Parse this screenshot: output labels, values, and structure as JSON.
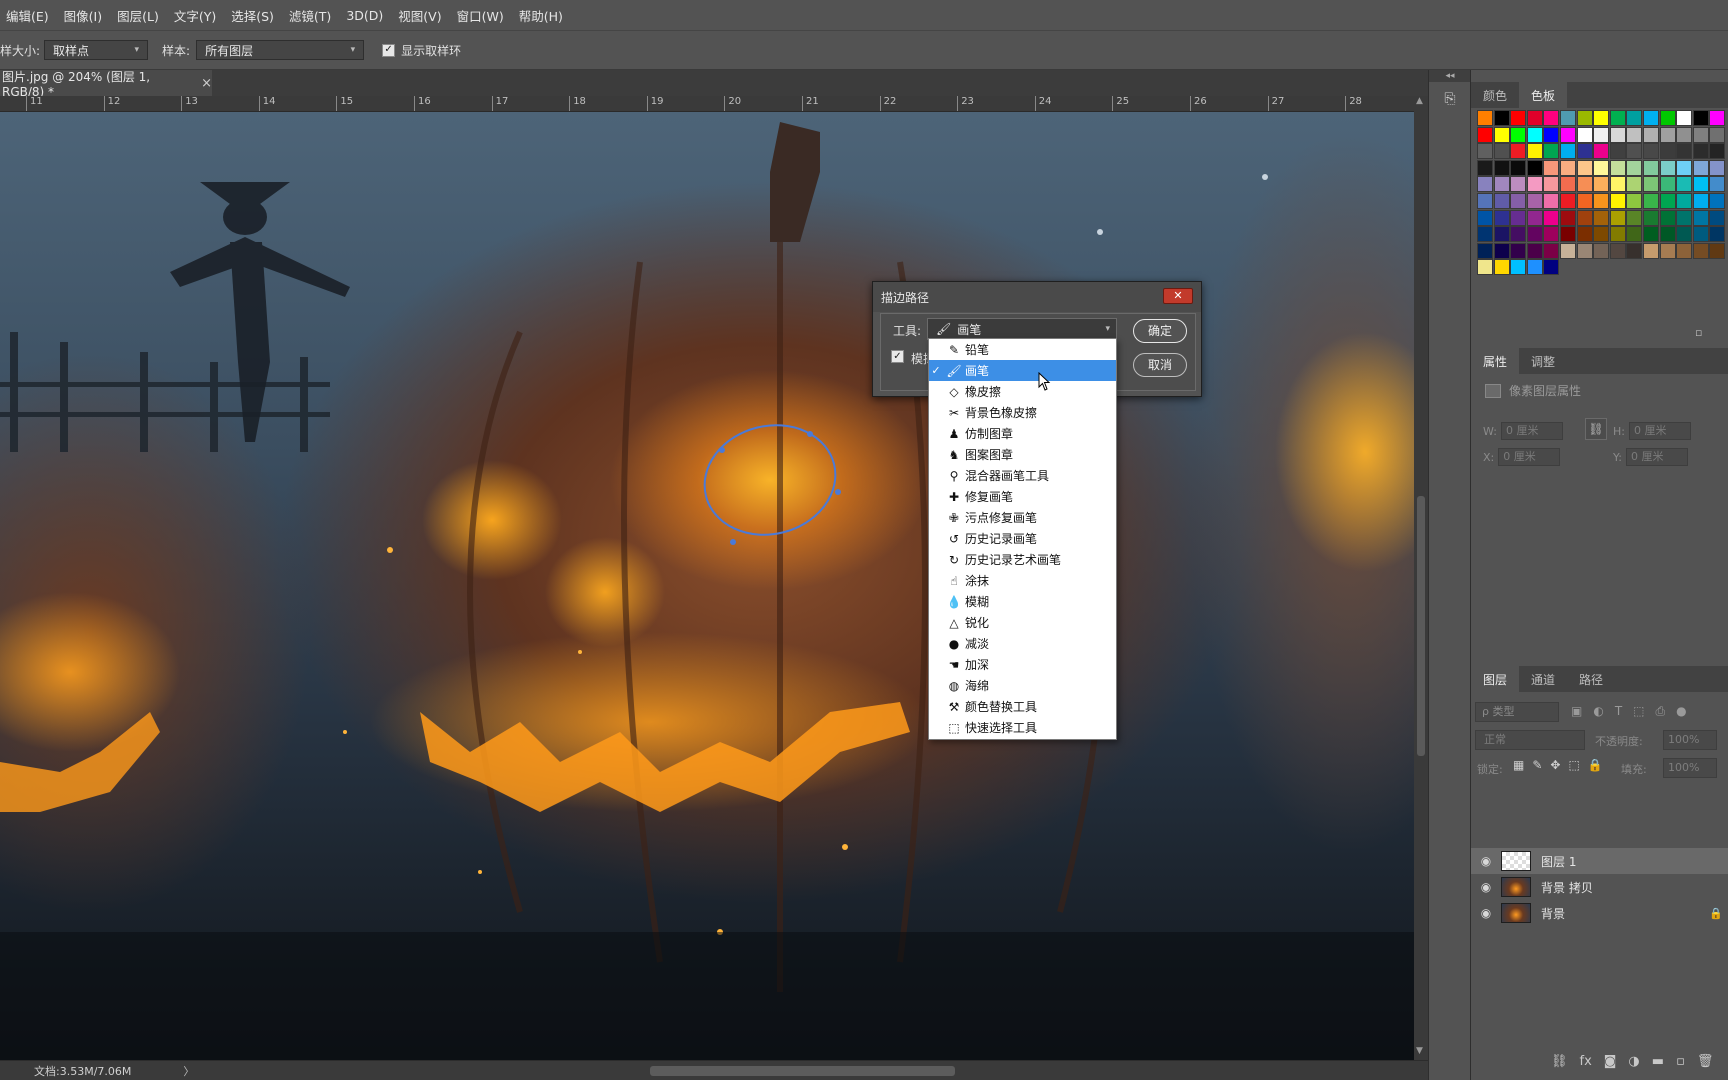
{
  "menubar": {
    "items": [
      "编辑(E)",
      "图像(I)",
      "图层(L)",
      "文字(Y)",
      "选择(S)",
      "滤镜(T)",
      "3D(D)",
      "视图(V)",
      "窗口(W)",
      "帮助(H)"
    ]
  },
  "options": {
    "sample_size_label": "样大小:",
    "sample_size_value": "取样点",
    "sample_label": "样本:",
    "sample_value": "所有图层",
    "show_ring_label": "显示取样环"
  },
  "document": {
    "tab_title": "图片.jpg @ 204% (图层 1, RGB/8) *",
    "close_glyph": "×",
    "status_text": "文档:3.53M/7.06M",
    "status_arrow": "〉"
  },
  "ruler": {
    "numbers": [
      "11",
      "12",
      "13",
      "14",
      "15",
      "16",
      "17",
      "18",
      "19",
      "20",
      "21",
      "22",
      "23",
      "24",
      "25",
      "26",
      "27",
      "28"
    ]
  },
  "dialog": {
    "title": "描边路径",
    "close_glyph": "✕",
    "tool_label": "工具:",
    "tool_value": "画笔",
    "simulate_label": "模拟",
    "ok_label": "确定",
    "cancel_label": "取消"
  },
  "tool_dropdown": {
    "selected_index": 1,
    "check_glyph": "✓",
    "items": [
      {
        "label": "铅笔",
        "icon": "pencil-icon",
        "glyph": "✎"
      },
      {
        "label": "画笔",
        "icon": "brush-icon",
        "glyph": "🖌"
      },
      {
        "label": "橡皮擦",
        "icon": "eraser-icon",
        "glyph": "◇"
      },
      {
        "label": "背景色橡皮擦",
        "icon": "background-eraser-icon",
        "glyph": "✂"
      },
      {
        "label": "仿制图章",
        "icon": "clone-stamp-icon",
        "glyph": "♟"
      },
      {
        "label": "图案图章",
        "icon": "pattern-stamp-icon",
        "glyph": "♞"
      },
      {
        "label": "混合器画笔工具",
        "icon": "mixer-brush-icon",
        "glyph": "⚲"
      },
      {
        "label": "修复画笔",
        "icon": "healing-brush-icon",
        "glyph": "✚"
      },
      {
        "label": "污点修复画笔",
        "icon": "spot-healing-icon",
        "glyph": "✙"
      },
      {
        "label": "历史记录画笔",
        "icon": "history-brush-icon",
        "glyph": "↺"
      },
      {
        "label": "历史记录艺术画笔",
        "icon": "art-history-brush-icon",
        "glyph": "↻"
      },
      {
        "label": "涂抹",
        "icon": "smudge-icon",
        "glyph": "☝"
      },
      {
        "label": "模糊",
        "icon": "blur-icon",
        "glyph": "💧"
      },
      {
        "label": "锐化",
        "icon": "sharpen-icon",
        "glyph": "△"
      },
      {
        "label": "减淡",
        "icon": "dodge-icon",
        "glyph": "●"
      },
      {
        "label": "加深",
        "icon": "burn-icon",
        "glyph": "☚"
      },
      {
        "label": "海绵",
        "icon": "sponge-icon",
        "glyph": "◍"
      },
      {
        "label": "颜色替换工具",
        "icon": "color-replacement-icon",
        "glyph": "⚒"
      },
      {
        "label": "快速选择工具",
        "icon": "quick-selection-icon",
        "glyph": "⬚"
      }
    ]
  },
  "panels": {
    "color_tabs": [
      "颜色",
      "色板"
    ],
    "props_tabs": [
      "属性",
      "调整"
    ],
    "props_title": "像素图层属性",
    "props_w": "W:",
    "props_h": "H:",
    "props_x": "X:",
    "props_y": "Y:",
    "props_value": "0 厘米",
    "layers_tabs": [
      "图层",
      "通道",
      "路径"
    ],
    "search_placeholder": "ρ 类型",
    "blend_mode": "正常",
    "opacity_label": "不透明度:",
    "opacity_value": "100%",
    "lock_label": "锁定:",
    "fill_label": "填充:",
    "fill_value": "100%",
    "layers": [
      {
        "name": "图层 1",
        "selected": true,
        "thumb": "transparent"
      },
      {
        "name": "背景 拷贝",
        "selected": false,
        "thumb": "image"
      },
      {
        "name": "背景",
        "selected": false,
        "thumb": "image",
        "locked": true
      }
    ]
  },
  "swatch_colors": [
    [
      "#ff7f00",
      "#000000",
      "#ff0000",
      "#e0002a",
      "#ff007f",
      "#4f9bb0",
      "#9ab900",
      "#ffff00",
      "#00b050",
      "#00a0a0",
      "#00b0f0",
      "#00c800",
      "#ffffff",
      "#000000",
      "#ff00ff"
    ],
    [
      "#ff0000",
      "#ffff00",
      "#00ff00",
      "#00ffff",
      "#0000ff",
      "#ff00ff",
      "#ffffff",
      "#f0f0f0",
      "#d8d8d8",
      "#c0c0c0",
      "#b0b0b0",
      "#a0a0a0",
      "#909090",
      "#808080",
      "#707070"
    ],
    [
      "#606060",
      "#505050",
      "#ee1c24",
      "#fff200",
      "#00a651",
      "#00aeef",
      "#2e3192",
      "#ec008c",
      "#404040",
      "#505050",
      "#484848",
      "#3c3c3c",
      "#343434",
      "#2c2c2c",
      "#242424"
    ],
    [
      "#1a1a1a",
      "#111111",
      "#0a0a0a",
      "#000000",
      "#f7977a",
      "#f9ad81",
      "#fdc68a",
      "#fff79a",
      "#c4df9b",
      "#a3d39c",
      "#82ca9d",
      "#7bcdc8",
      "#6ecff6",
      "#7ea7d8",
      "#8493ca"
    ],
    [
      "#8882be",
      "#a187be",
      "#bc8dbf",
      "#f49ac2",
      "#f6989d",
      "#f26c4f",
      "#f68e55",
      "#fbaf5c",
      "#fff467",
      "#acd372",
      "#7cc576",
      "#3bb878",
      "#1abbb4",
      "#00bff3",
      "#438ccb"
    ],
    [
      "#5574b9",
      "#605ca8",
      "#855fa8",
      "#a763a8",
      "#f06ea9",
      "#ed1c24",
      "#f26522",
      "#f7941d",
      "#fff200",
      "#8dc73f",
      "#39b54a",
      "#00a651",
      "#00a99d",
      "#00aeef",
      "#0072bc"
    ],
    [
      "#0054a6",
      "#2e3192",
      "#662d91",
      "#92278f",
      "#ec008c",
      "#9e0b0f",
      "#a0410d",
      "#a36209",
      "#aba000",
      "#598527",
      "#197b30",
      "#007236",
      "#00746b",
      "#0076a3",
      "#004b80"
    ],
    [
      "#003471",
      "#1b1464",
      "#440e62",
      "#630460",
      "#9e005d",
      "#790000",
      "#7b2e00",
      "#7d4900",
      "#827b00",
      "#406618",
      "#005e20",
      "#005826",
      "#005952",
      "#005b7f",
      "#003663"
    ],
    [
      "#002157",
      "#0d004c",
      "#32004b",
      "#4b0049",
      "#7b0046",
      "#c7b299",
      "#998675",
      "#736357",
      "#534741",
      "#37302d",
      "#c69c6d",
      "#a67c52",
      "#8c6239",
      "#754c24",
      "#603913"
    ],
    [
      "#f0e68c",
      "#ffd700",
      "#00bfff",
      "#1e90ff",
      "#000080"
    ]
  ]
}
